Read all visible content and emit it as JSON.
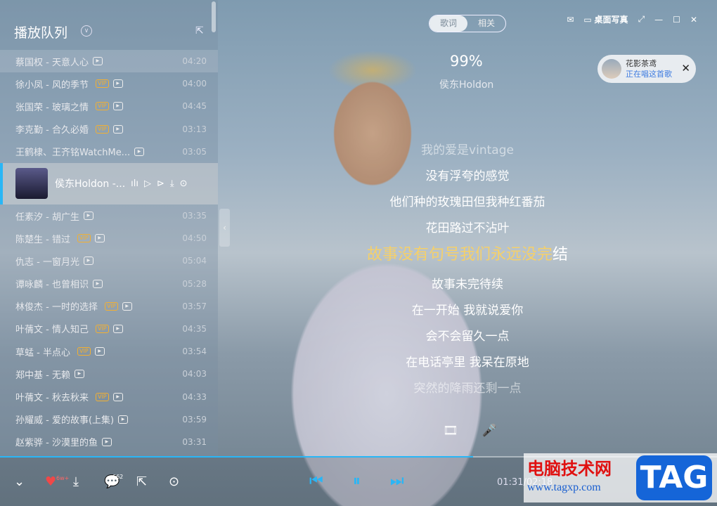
{
  "sidebar": {
    "title": "播放队列",
    "items": [
      {
        "title": "蔡国权 - 天意人心",
        "vip": false,
        "mv": true,
        "duration": "04:20"
      },
      {
        "title": "徐小凤 - 风的季节",
        "vip": true,
        "mv": true,
        "duration": "04:00"
      },
      {
        "title": "张国荣 - 玻璃之情",
        "vip": true,
        "mv": true,
        "duration": "04:45"
      },
      {
        "title": "李克勤 - 合久必婚",
        "vip": true,
        "mv": true,
        "duration": "03:13"
      },
      {
        "title": "王鹤棣、王齐铭WatchMe...",
        "vip": false,
        "mv": true,
        "duration": "03:05"
      }
    ],
    "current": {
      "title": "侯东Holdon -..."
    },
    "items2": [
      {
        "title": "任素汐 - 胡广生",
        "vip": false,
        "duration": "03:35"
      },
      {
        "title": "陈楚生 - 错过",
        "vip": true,
        "duration": "04:50"
      },
      {
        "title": "仇志 - 一窗月光",
        "vip": false,
        "duration": "05:04"
      },
      {
        "title": "谭咏麟 - 也曾相识",
        "vip": false,
        "duration": "05:28"
      },
      {
        "title": "林俊杰 - 一时的选择",
        "vip": true,
        "duration": "03:57"
      },
      {
        "title": "叶蒨文 - 情人知己",
        "vip": true,
        "duration": "04:35"
      },
      {
        "title": "草蜢 - 半点心",
        "vip": true,
        "duration": "03:54"
      },
      {
        "title": "郑中基 - 无赖",
        "vip": false,
        "duration": "04:03"
      },
      {
        "title": "叶蒨文 - 秋去秋来",
        "vip": true,
        "duration": "04:33"
      },
      {
        "title": "孙耀威 - 爱的故事(上集)",
        "vip": false,
        "duration": "03:59"
      },
      {
        "title": "赵紫骅 - 沙漠里的鱼",
        "vip": false,
        "duration": "03:31"
      }
    ],
    "vip_label": "VIP"
  },
  "tabs": [
    "歌词",
    "相关"
  ],
  "window": {
    "desktop_label": "桌面写真"
  },
  "song": {
    "percent": "99%",
    "artist": "侯东Holdon"
  },
  "bubble": {
    "name": "花影茶鸢",
    "status": "正在唱这首歌"
  },
  "lyrics": {
    "lines": [
      "我的爱是vintage",
      "没有浮夸的感觉",
      "他们种的玫瑰田但我种红番茄",
      "花田路过不沾叶"
    ],
    "active_sung": "故事没有句号我们永远没完",
    "active_rest": "结",
    "after": [
      "故事未完待续",
      "在一开始 我就说爱你",
      "会不会留久一点",
      "在电话亭里 我呆在原地",
      "突然的降雨还剩一点"
    ]
  },
  "player": {
    "like_count": "6w+",
    "comment_count": "662",
    "time": "01:31/02:18",
    "progress": 0.66,
    "accent": "#29b6f6"
  },
  "watermark": {
    "text1": "电脑技术网",
    "text2": "www.tagxp.com",
    "logo": "TAG"
  }
}
